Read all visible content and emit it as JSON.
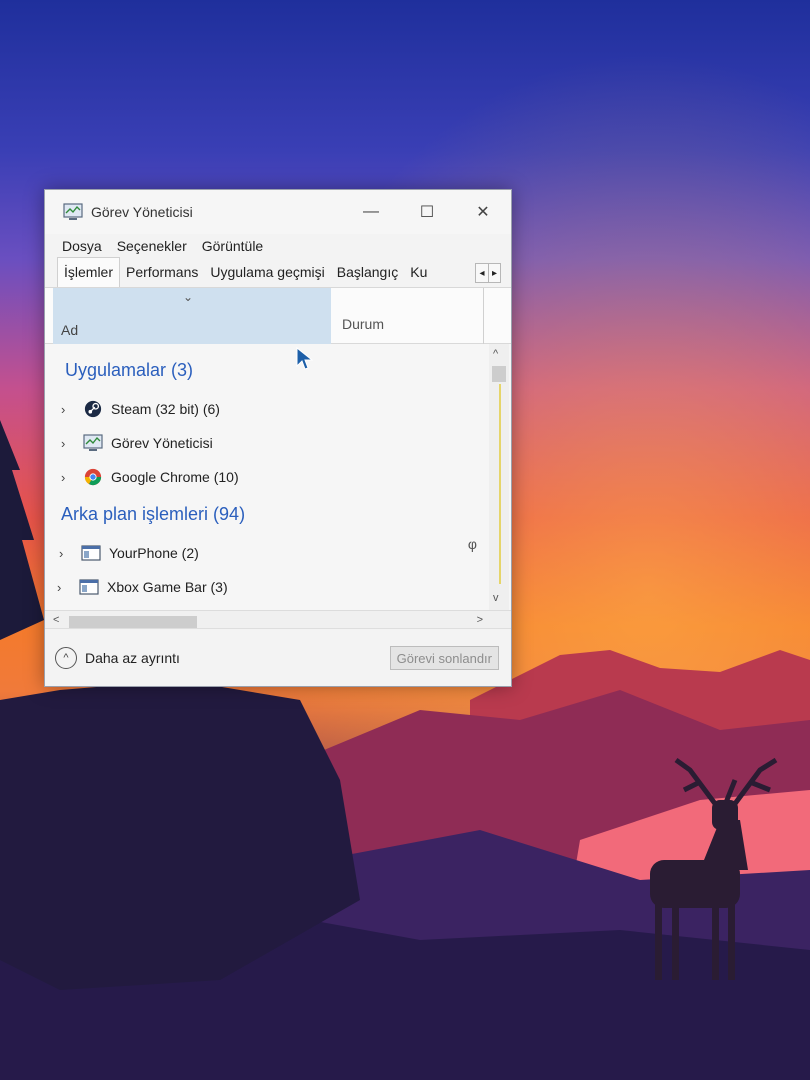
{
  "window": {
    "title": "Görev Yöneticisi",
    "minimize_glyph": "—",
    "maximize_glyph": "☐",
    "close_glyph": "✕"
  },
  "menu": [
    "Dosya",
    "Seçenekler",
    "Görüntüle"
  ],
  "tabs": [
    {
      "label": "İşlemler",
      "active": true
    },
    {
      "label": "Performans",
      "active": false
    },
    {
      "label": "Uygulama geçmişi",
      "active": false
    },
    {
      "label": "Başlangıç",
      "active": false
    },
    {
      "label": "Ku",
      "active": false
    }
  ],
  "columns": {
    "name": "Ad",
    "status": "Durum",
    "sort_glyph": "⌄"
  },
  "groups": {
    "apps": {
      "label": "Uygulamalar (3)",
      "items": [
        {
          "label": "Steam (32 bit) (6)",
          "icon": "steam-icon"
        },
        {
          "label": "Görev Yöneticisi",
          "icon": "task-manager-icon"
        },
        {
          "label": "Google Chrome (10)",
          "icon": "chrome-icon"
        }
      ]
    },
    "background": {
      "label": "Arka plan işlemleri (94)",
      "items": [
        {
          "label": "YourPhone (2)",
          "icon": "app-window-icon"
        },
        {
          "label": "Xbox Game Bar (3)",
          "icon": "app-window-icon"
        }
      ]
    }
  },
  "glyphs": {
    "expand": "›",
    "scroll_up": "^",
    "scroll_down": "v",
    "scroll_left": "<",
    "scroll_right": ">",
    "tab_left": "◂",
    "tab_right": "▸",
    "pin": "φ",
    "collapse": "^"
  },
  "footer": {
    "less_details": "Daha az ayrıntı",
    "end_task": "Görevi sonlandır"
  },
  "colors": {
    "group_heading": "#2b5fbd",
    "selected_column": "#cfe0ef"
  }
}
